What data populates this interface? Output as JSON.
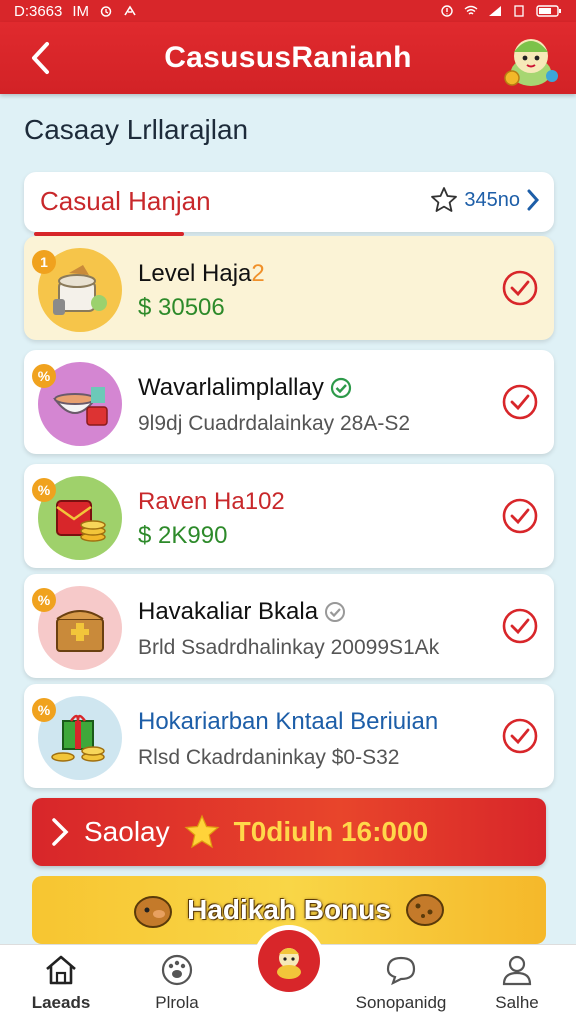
{
  "status_bar": {
    "time": "D:3663",
    "carrier": "IM"
  },
  "app_bar": {
    "title": "CasususRanianh",
    "back_icon": "chevron-left-icon",
    "mascot": "mascot-icon"
  },
  "heading": "Casaay Lrllarajlan",
  "tab": {
    "title": "Casual Hanjan",
    "right_label": "345no",
    "star_icon": "star-outline-icon"
  },
  "items": [
    {
      "badge": "1",
      "name": "Level Haja",
      "name_suffix": "2",
      "subtitle": "$ 30506",
      "verified": false,
      "icon": "rice-cooker-icon",
      "bg": "#f6c54a"
    },
    {
      "badge": "%",
      "name": "Wavarlalimplallay",
      "subtitle": "9l9dj Cuadrdalainkay 28A-S2",
      "verified": true,
      "icon": "bowl-icon",
      "bg": "#d486d2"
    },
    {
      "badge": "%",
      "name": "Raven Ha102",
      "subtitle": "$ 2K990",
      "verified": false,
      "icon": "red-envelope-icon",
      "bg": "#9fd16b"
    },
    {
      "badge": "%",
      "name": "Havakaliar Bkala",
      "subtitle": "Brld Ssadrdhalinkay 20099S1Ak",
      "verified": true,
      "icon": "treasure-chest-icon",
      "bg": "#f6c9c9"
    },
    {
      "badge": "%",
      "name": "Hokariarban Kntaal Beriuian",
      "subtitle": "Rlsd Ckadrdaninkay $0-S32",
      "verified": false,
      "icon": "gift-coins-icon",
      "bg": "#cfe6f0"
    }
  ],
  "banner_red": {
    "label": "Saolay",
    "amount": "T0diuln 16:000"
  },
  "banner_yellow": {
    "label": "Hadikah Bonus"
  },
  "bottom_nav": [
    {
      "label": "Laeads",
      "icon": "home-icon"
    },
    {
      "label": "Plrola",
      "icon": "paw-icon"
    },
    {
      "label": "Sonopanidg",
      "icon": "chat-icon"
    },
    {
      "label": "Salhe",
      "icon": "user-icon"
    }
  ],
  "colors": {
    "primary_red": "#d8262a",
    "green_money": "#2d8a2a",
    "gold": "#ffd84a",
    "blue_link": "#1d5ea8"
  }
}
